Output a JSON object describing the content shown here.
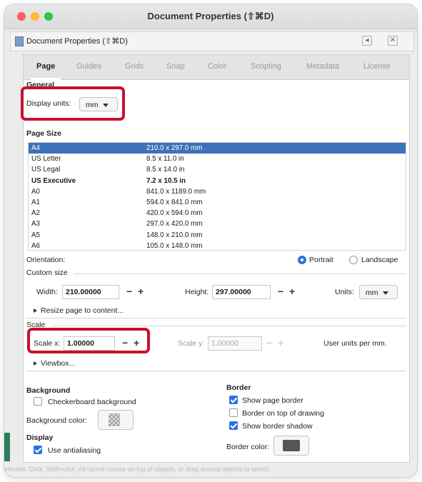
{
  "window": {
    "title": "Document Properties (⇧⌘D)"
  },
  "dock": {
    "title": "Document Properties (⇧⌘D)",
    "ctl1": "◂",
    "ctl2": "✕"
  },
  "tabs": [
    "Page",
    "Guides",
    "Grids",
    "Snap",
    "Color",
    "Scripting",
    "Metadata",
    "License"
  ],
  "general": {
    "heading": "General",
    "display_units_label": "Display units:",
    "display_units_value": "mm"
  },
  "page_size": {
    "heading": "Page Size",
    "rows": [
      {
        "name": "A4",
        "size": "210.0 x 297.0 mm",
        "selected": true
      },
      {
        "name": "US Letter",
        "size": "8.5 x 11.0 in"
      },
      {
        "name": "US Legal",
        "size": "8.5 x 14.0 in"
      },
      {
        "name": "US Executive",
        "size": "7.2 x 10.5 in",
        "bold": true
      },
      {
        "name": "A0",
        "size": "841.0 x 1189.0 mm"
      },
      {
        "name": "A1",
        "size": "594.0 x 841.0 mm"
      },
      {
        "name": "A2",
        "size": "420.0 x 594.0 mm"
      },
      {
        "name": "A3",
        "size": "297.0 x 420.0 mm"
      },
      {
        "name": "A5",
        "size": "148.0 x 210.0 mm"
      },
      {
        "name": "A6",
        "size": "105.0 x 148.0 mm"
      }
    ]
  },
  "orientation": {
    "label": "Orientation:",
    "portrait": "Portrait",
    "landscape": "Landscape",
    "selected": "Portrait"
  },
  "custom_size": {
    "heading": "Custom size",
    "width_label": "Width:",
    "width_value": "210.00000",
    "height_label": "Height:",
    "height_value": "297.00000",
    "units_label": "Units:",
    "units_value": "mm",
    "resize_label": "Resize page to content..."
  },
  "scale": {
    "heading": "Scale",
    "scale_x_label": "Scale x:",
    "scale_x_value": "1.00000",
    "scale_y_label": "Scale y:",
    "scale_y_value": "1.00000",
    "units_note": "User units per mm.",
    "viewbox_label": "Viewbox..."
  },
  "background": {
    "heading": "Background",
    "checkerboard_label": "Checkerboard background",
    "checkerboard": false,
    "color_label": "Background color:"
  },
  "border": {
    "heading": "Border",
    "show_border_label": "Show page border",
    "show_border": true,
    "on_top_label": "Border on top of drawing",
    "on_top": false,
    "shadow_label": "Show border shadow",
    "shadow": true,
    "color_label": "Border color:",
    "color": "#555555"
  },
  "display": {
    "heading": "Display",
    "antialias_label": "Use antialiasing",
    "antialias": true
  },
  "status": {
    "text": "elected. Click, Shift+click, Alt+scroll mouse on top of objects, or drag around objects to select."
  },
  "colors": {
    "highlight": "#c8102e",
    "accent": "#2f74d9",
    "selection": "#3d72b8"
  }
}
